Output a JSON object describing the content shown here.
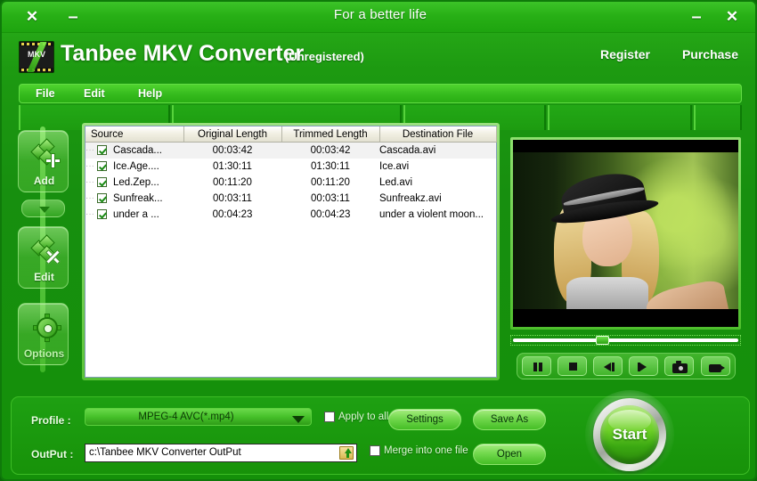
{
  "window": {
    "title": "For a better life",
    "close_left_icon": "close-icon",
    "minimize_left_icon": "minimize-icon",
    "minimize_right_icon": "minimize-icon",
    "close_right_icon": "close-icon",
    "close_glyph": "✕",
    "minimize_glyph": "–"
  },
  "brand": {
    "name": "Tanbee MKV Converter",
    "status": "(Unregistered)",
    "logo_text": "MKV",
    "logo_icon": "film-strip-mkv-icon"
  },
  "header_links": [
    {
      "label": "Register",
      "name": "register-link"
    },
    {
      "label": "Purchase",
      "name": "purchase-link"
    }
  ],
  "menu": {
    "items": [
      {
        "label": "File",
        "name": "menu-file"
      },
      {
        "label": "Edit",
        "name": "menu-edit"
      },
      {
        "label": "Help",
        "name": "menu-help"
      }
    ]
  },
  "sidebar": {
    "buttons": [
      {
        "label": "Add",
        "name": "add-button",
        "icon": "add-files-icon"
      },
      {
        "label": "Edit",
        "name": "edit-button",
        "icon": "edit-clip-icon"
      },
      {
        "label": "Options",
        "name": "options-button",
        "icon": "gear-icon"
      }
    ],
    "dropdown_icon": "chevron-down-icon"
  },
  "file_list": {
    "columns": [
      "Source",
      "Original Length",
      "Trimmed Length",
      "Destination File"
    ],
    "rows": [
      {
        "checked": true,
        "source": "Cascada...",
        "original": "00:03:42",
        "trimmed": "00:03:42",
        "destination": "Cascada.avi"
      },
      {
        "checked": true,
        "source": "Ice.Age....",
        "original": "01:30:11",
        "trimmed": "01:30:11",
        "destination": "Ice.avi"
      },
      {
        "checked": true,
        "source": "Led.Zep...",
        "original": "00:11:20",
        "trimmed": "00:11:20",
        "destination": "Led.avi"
      },
      {
        "checked": true,
        "source": "Sunfreak...",
        "original": "00:03:11",
        "trimmed": "00:03:11",
        "destination": "Sunfreakz.avi"
      },
      {
        "checked": true,
        "source": "under a ...",
        "original": "00:04:23",
        "trimmed": "00:04:23",
        "destination": "under a violent moon..."
      }
    ]
  },
  "preview": {
    "name": "video-preview",
    "seek_position_percent": 38,
    "transport": [
      {
        "name": "pause-button",
        "icon": "pause-icon"
      },
      {
        "name": "stop-button",
        "icon": "stop-icon"
      },
      {
        "name": "previous-button",
        "icon": "previous-icon"
      },
      {
        "name": "next-button",
        "icon": "next-icon"
      },
      {
        "name": "snapshot-button",
        "icon": "camera-icon"
      },
      {
        "name": "record-button",
        "icon": "camcorder-icon"
      }
    ]
  },
  "bottom": {
    "profile_label": "Profile :",
    "profile_value": "MPEG-4 AVC(*.mp4)",
    "output_label": "OutPut :",
    "output_value": "c:\\Tanbee MKV Converter OutPut",
    "apply_to_all_label": "Apply to all",
    "apply_to_all_checked": false,
    "merge_label": "Merge into one file",
    "merge_checked": false,
    "settings_label": "Settings",
    "save_as_label": "Save As",
    "open_label": "Open",
    "browse_icon": "folder-browse-icon"
  },
  "start": {
    "label": "Start",
    "name": "start-button"
  },
  "colors": {
    "background_green": "#1a9612",
    "titlebar_green": "#28b016",
    "accent_light_green": "#6ed128",
    "list_background": "#ffffff"
  }
}
